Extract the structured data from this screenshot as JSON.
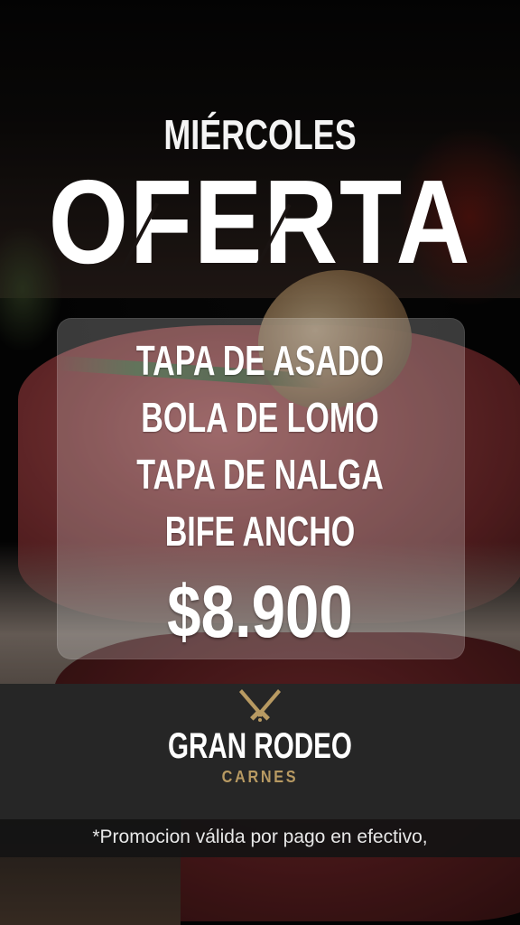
{
  "headline": {
    "day": "MIÉRCOLES",
    "title": "OFERTA"
  },
  "offer": {
    "items": [
      "TAPA DE ASADO",
      "BOLA DE LOMO",
      "TAPA DE NALGA",
      "BIFE ANCHO"
    ],
    "price": "$8.900"
  },
  "brand": {
    "name": "GRAN RODEO",
    "subtitle": "CARNES",
    "icon": "crossed-knives-icon",
    "accent_color": "#b89a62"
  },
  "footnote": {
    "text": "*Promocion válida por pago en efectivo,"
  },
  "colors": {
    "headline": "#ffffff",
    "brand_band": "#262626",
    "panel_tint": "rgba(255,255,255,0.22)"
  }
}
